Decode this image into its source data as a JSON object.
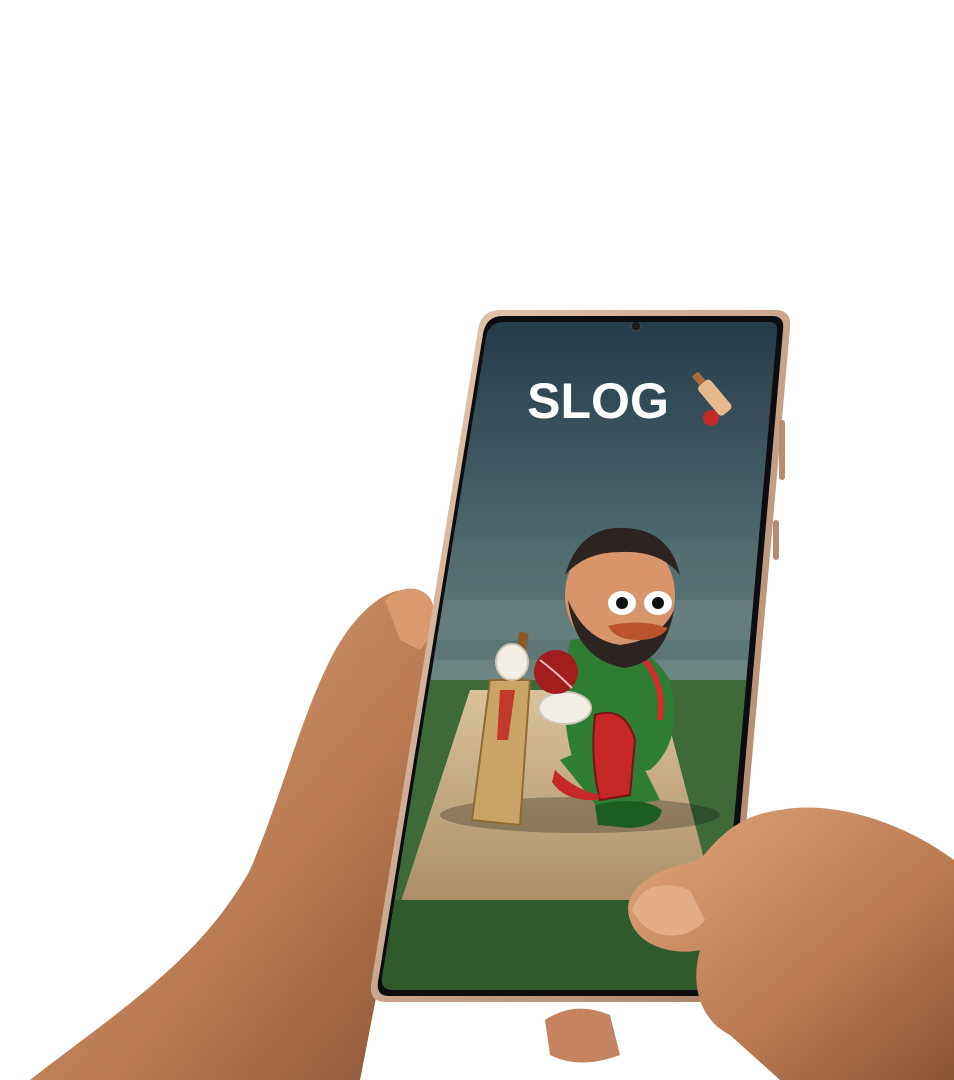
{
  "app": {
    "title": "SLOG",
    "title_icon": "cricket-bat-and-ball-emoji"
  },
  "colors": {
    "background": "#ffffff",
    "phone_frame": "#c9a48a",
    "screen_sky": "#2c4552",
    "field_green": "#3f6b37",
    "pitch_tan": "#c8a97d",
    "jersey_green": "#2e7d32",
    "jersey_red": "#d32f2f",
    "skin_hand": "#c98c62"
  }
}
